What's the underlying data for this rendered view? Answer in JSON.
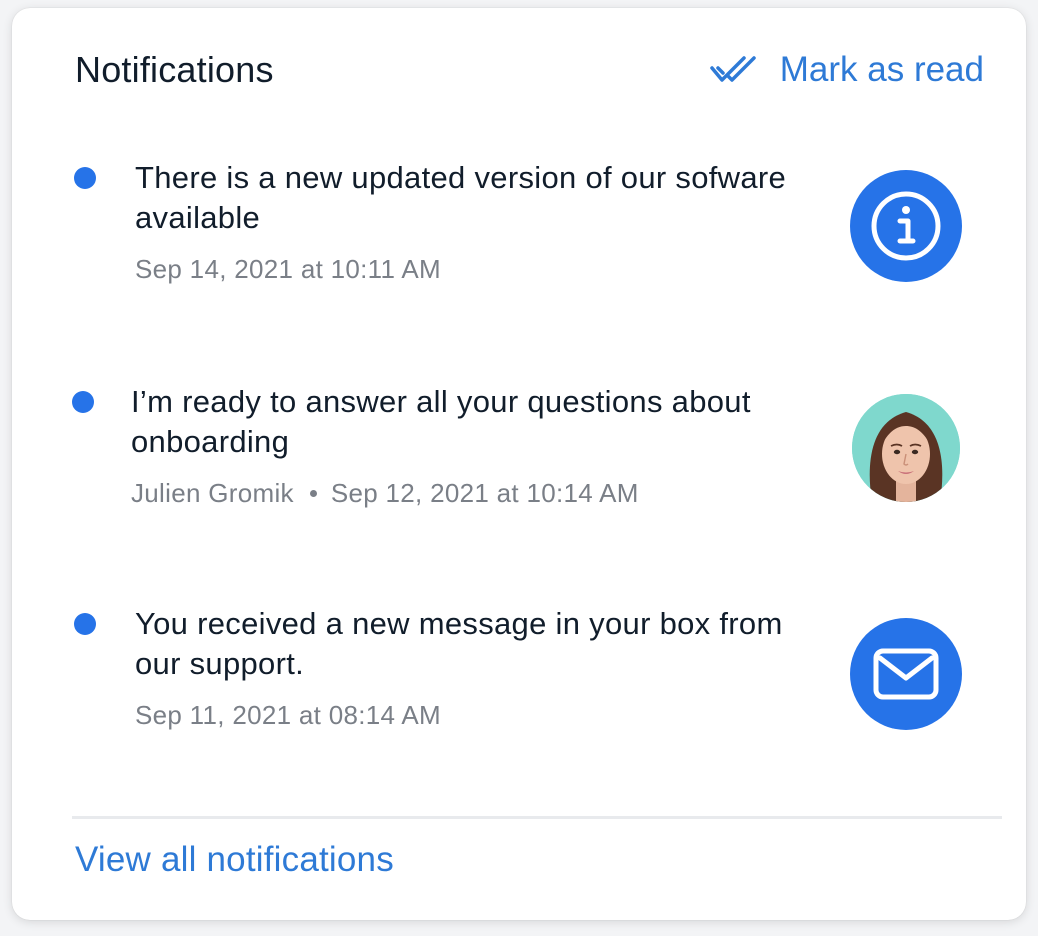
{
  "header": {
    "title": "Notifications",
    "mark_as_read_label": "Mark as read",
    "mark_as_read_icon": "double-check-icon"
  },
  "notifications": [
    {
      "unread": true,
      "message": "There is a new updated version of our sofware available",
      "author": "",
      "timestamp": "Sep 14, 2021 at 10:11 AM",
      "icon": "info-icon"
    },
    {
      "unread": true,
      "message": "I’m ready to answer all your questions about onboarding",
      "author": "Julien Gromik",
      "timestamp": "Sep 12, 2021 at 10:14 AM",
      "icon": "avatar"
    },
    {
      "unread": true,
      "message": "You received a new message in your box from our support.",
      "author": "",
      "timestamp": "Sep 11, 2021 at 08:14 AM",
      "icon": "mail-icon"
    }
  ],
  "footer": {
    "view_all_label": "View all notifications"
  },
  "colors": {
    "accent": "#2673e8",
    "link": "#2e7ad6",
    "text": "#111d2b",
    "muted": "#7a7f87"
  }
}
